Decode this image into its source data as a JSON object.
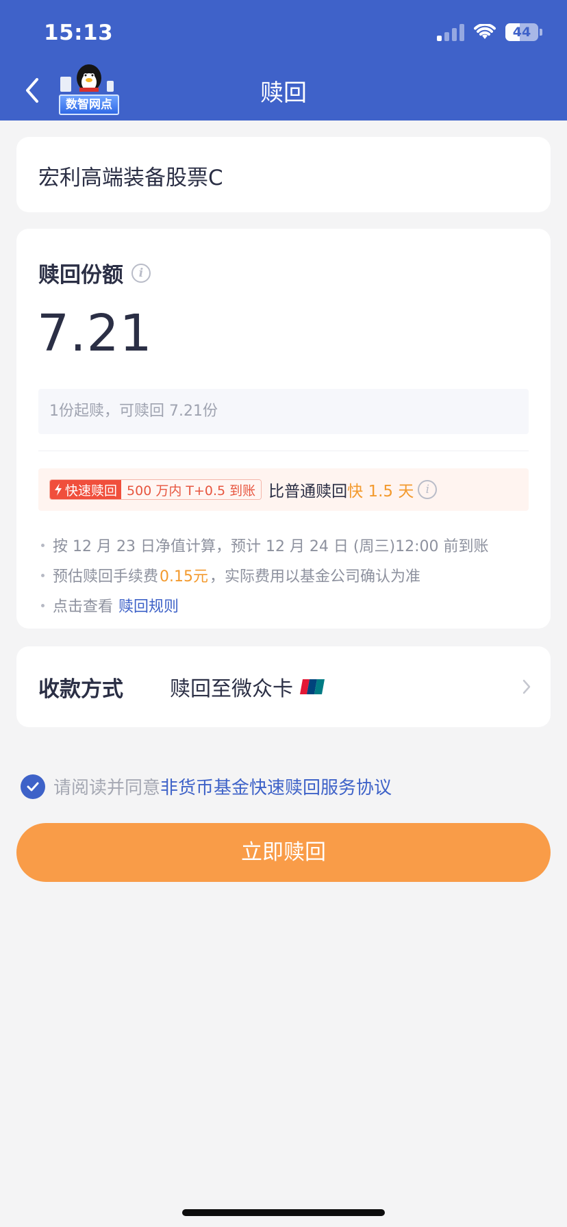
{
  "status_bar": {
    "time": "15:13",
    "battery": "44",
    "battery_level": 0.44
  },
  "header": {
    "title": "赎回",
    "mascot_badge": "数智网点"
  },
  "fund": {
    "name": "宏利高端装备股票C"
  },
  "redeem": {
    "label": "赎回份额",
    "amount": "7.21",
    "hint": "1份起赎，可赎回 7.21份"
  },
  "fast_redeem": {
    "tag": "快速赎回",
    "tag_sub": "500 万内 T+0.5 到账",
    "compare_text": "比普通赎回",
    "speed": "快 1.5 天"
  },
  "notes": {
    "settlement": "按 12 月 23 日净值计算，预计 12 月 24 日 (周三)12:00 前到账",
    "fee_prefix": "预估赎回手续费",
    "fee_value": "0.15元",
    "fee_suffix": "，实际费用以基金公司确认为准",
    "rule_prefix": "点击查看",
    "rule_link": "赎回规则"
  },
  "payment": {
    "label": "收款方式",
    "value": "赎回至微众卡",
    "card_icon": "unionpay-icon"
  },
  "agreement": {
    "prefix": "请阅读并同意",
    "link": "非货币基金快速赎回服务协议",
    "checked": true
  },
  "submit": {
    "label": "立即赎回"
  },
  "colors": {
    "header_bg": "#3f62c9",
    "accent_blue": "#3e62c8",
    "orange": "#f99c48",
    "highlight_orange": "#f39a2e",
    "red_tag": "#f04f3c",
    "page_bg": "#f4f4f5"
  }
}
